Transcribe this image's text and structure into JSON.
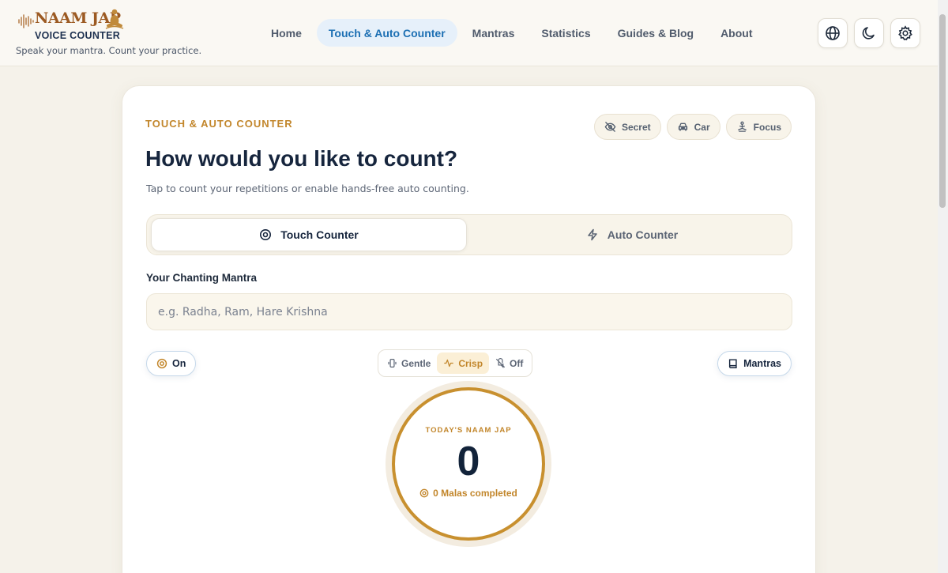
{
  "brand": {
    "logo_word": "NAAM JAP",
    "logo_sub": "VOICE COUNTER",
    "tagline": "Speak your mantra. Count your practice.",
    "accent_color": "#c2862b",
    "primary_color": "#1c6fb3"
  },
  "nav": {
    "items": [
      {
        "label": "Home",
        "active": false
      },
      {
        "label": "Touch & Auto Counter",
        "active": true
      },
      {
        "label": "Mantras",
        "active": false
      },
      {
        "label": "Statistics",
        "active": false
      },
      {
        "label": "Guides & Blog",
        "active": false
      },
      {
        "label": "About",
        "active": false
      }
    ],
    "icons": [
      "globe-icon",
      "moon-icon",
      "gear-icon"
    ]
  },
  "card": {
    "eyebrow": "TOUCH & AUTO COUNTER",
    "title": "How would you like to count?",
    "subtitle": "Tap to count your repetitions or enable hands-free auto counting.",
    "modes": [
      {
        "label": "Secret",
        "icon": "eye-off-icon"
      },
      {
        "label": "Car",
        "icon": "car-icon"
      },
      {
        "label": "Focus",
        "icon": "focus-icon"
      }
    ],
    "segments": [
      {
        "label": "Touch Counter",
        "icon": "target-icon",
        "active": true
      },
      {
        "label": "Auto Counter",
        "icon": "lightning-icon",
        "active": false
      }
    ],
    "mantra_label": "Your Chanting Mantra",
    "mantra_value": "",
    "mantra_placeholder": "e.g. Radha, Ram, Hare Krishna",
    "sound_toggle": "On",
    "haptics": [
      {
        "label": "Gentle",
        "icon": "vibrate-icon",
        "active": false
      },
      {
        "label": "Crisp",
        "icon": "pulse-icon",
        "active": true
      },
      {
        "label": "Off",
        "icon": "mute-icon",
        "active": false
      }
    ],
    "mantras_button": "Mantras",
    "counter": {
      "label": "TODAY'S NAAM JAP",
      "value": "0",
      "malas": "0 Malas completed"
    }
  }
}
